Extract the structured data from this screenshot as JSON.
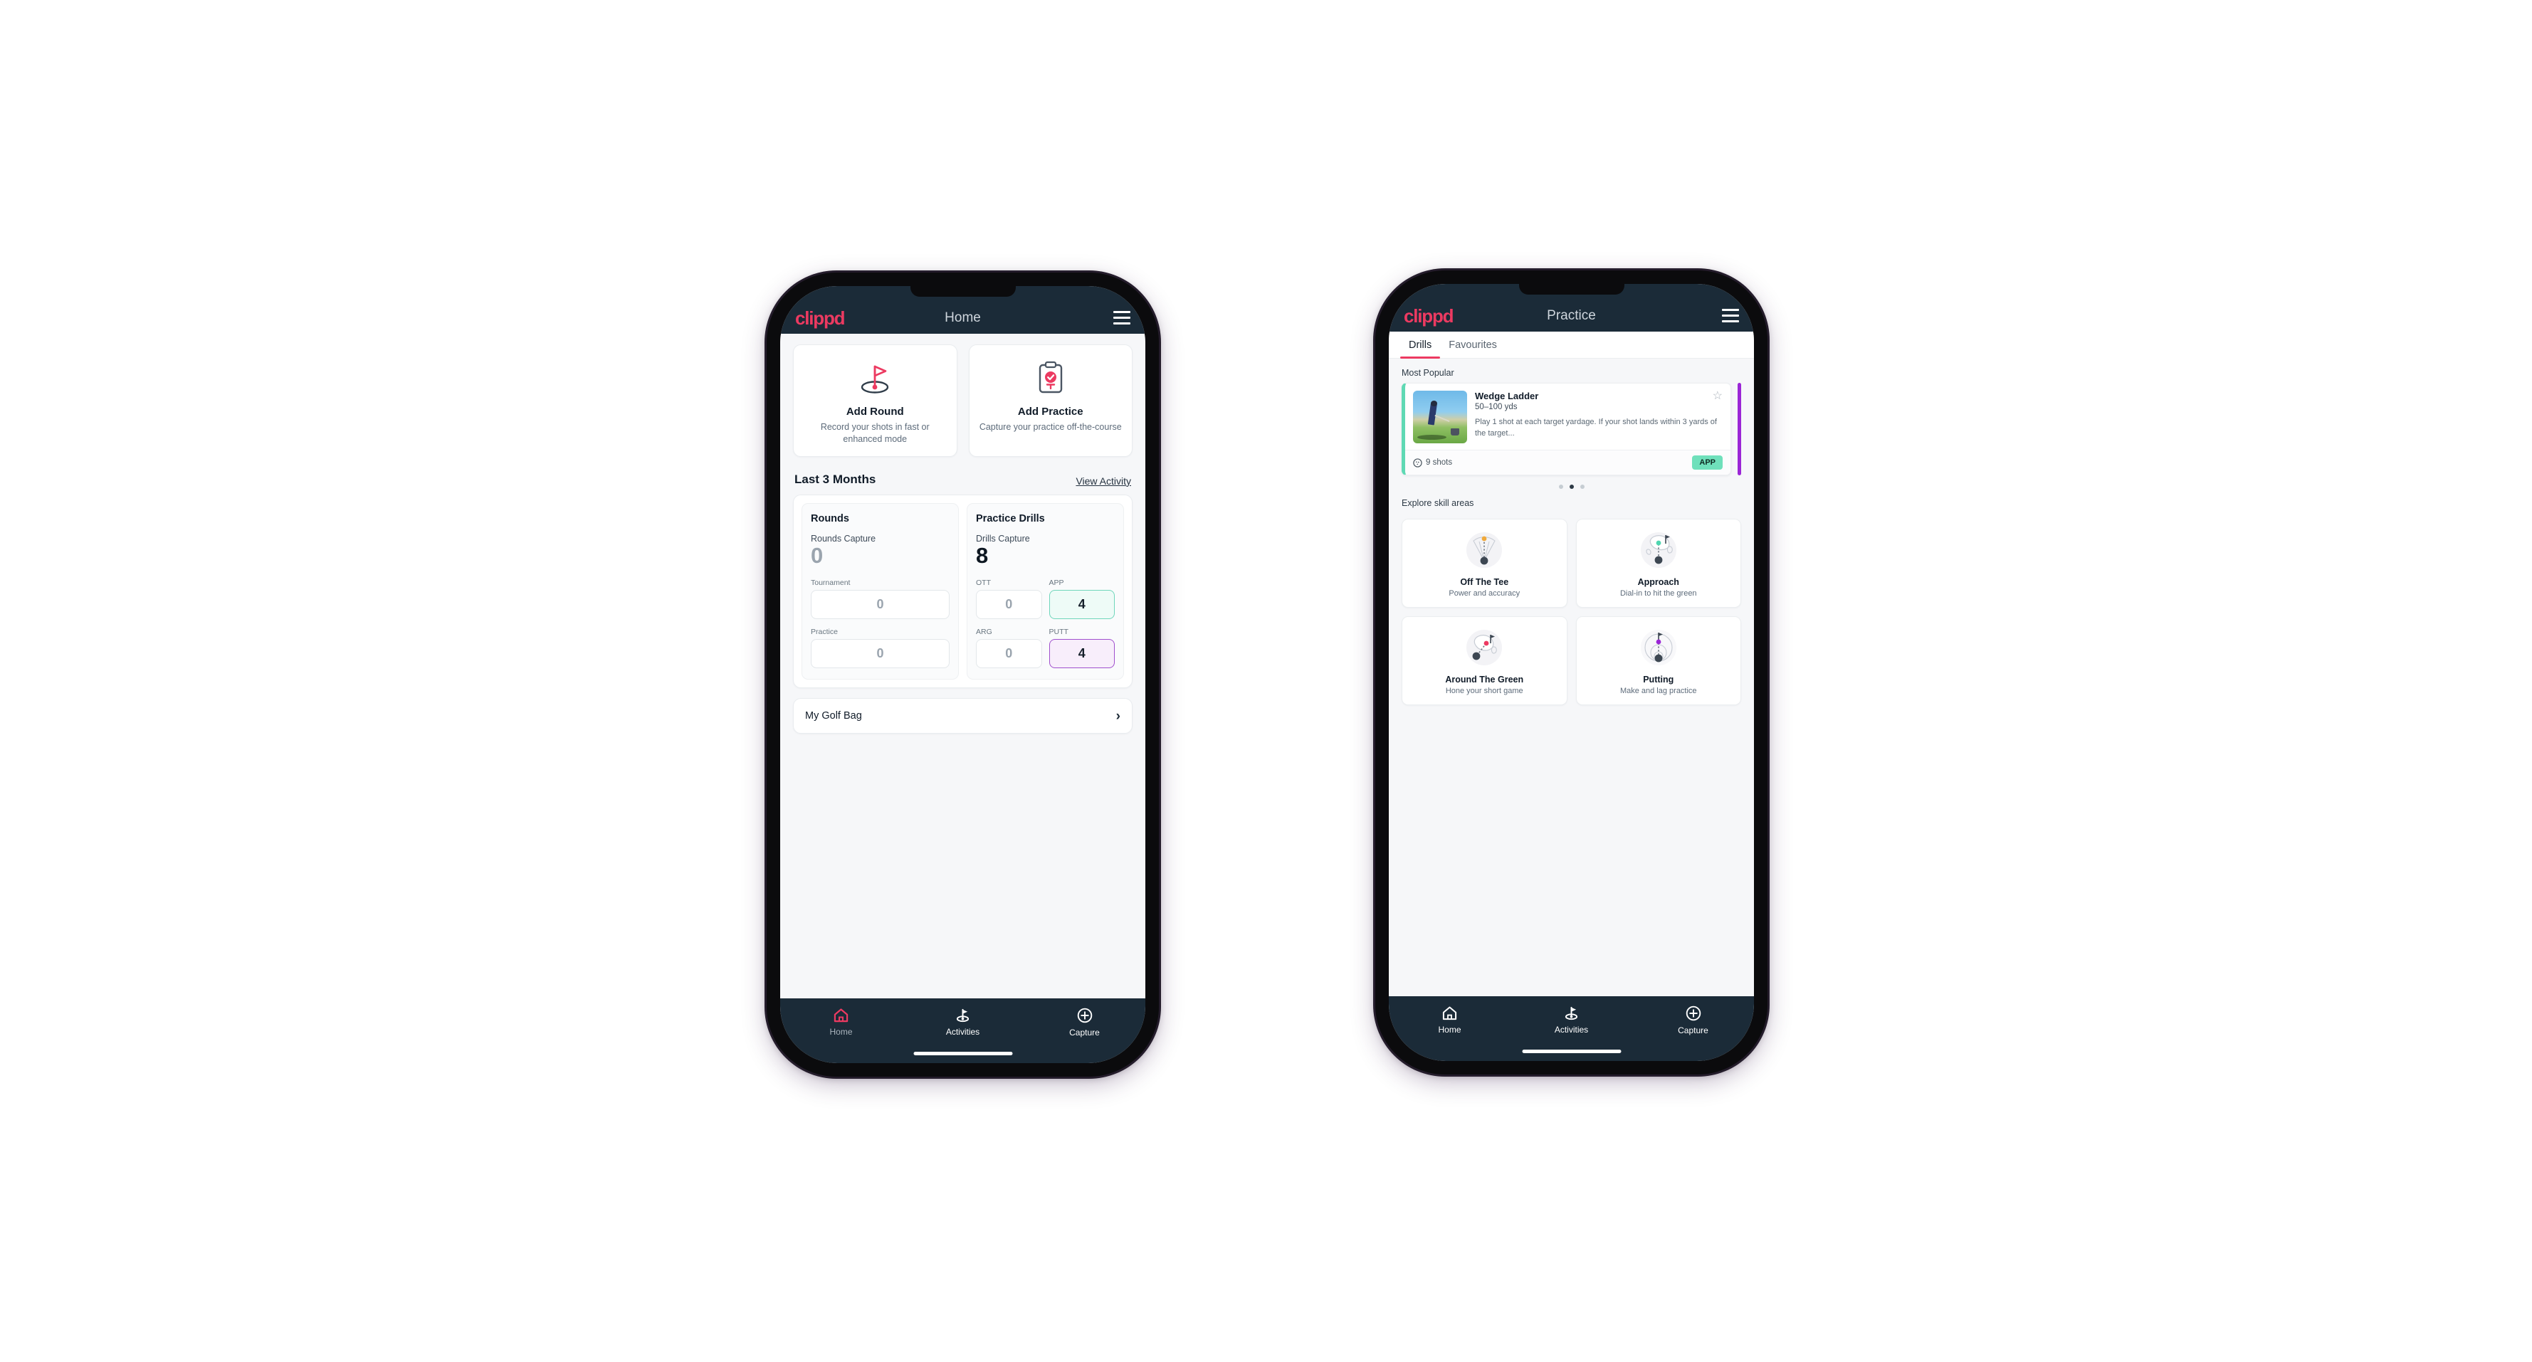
{
  "brand": {
    "name": "clippd",
    "accent": "#ec3a61",
    "navy": "#1b2b38"
  },
  "phone1": {
    "appbar": {
      "logo": "clippd",
      "title": "Home",
      "menu_icon": "hamburger-icon"
    },
    "quick_actions": [
      {
        "icon": "golf-flag-icon",
        "title": "Add Round",
        "subtitle": "Record your shots in fast or enhanced mode"
      },
      {
        "icon": "clipboard-check-icon",
        "title": "Add Practice",
        "subtitle": "Capture your practice off-the-course"
      }
    ],
    "section": {
      "title": "Last 3 Months",
      "link": "View Activity"
    },
    "rounds": {
      "heading": "Rounds",
      "capture_label": "Rounds Capture",
      "capture_value": "0",
      "fields": [
        {
          "label": "Tournament",
          "value": "0",
          "state": "empty"
        },
        {
          "label": "Practice",
          "value": "0",
          "state": "empty"
        }
      ]
    },
    "drills": {
      "heading": "Practice Drills",
      "capture_label": "Drills Capture",
      "capture_value": "8",
      "fields": [
        {
          "label": "OTT",
          "value": "0",
          "state": "empty"
        },
        {
          "label": "APP",
          "value": "4",
          "state": "app"
        },
        {
          "label": "ARG",
          "value": "0",
          "state": "empty"
        },
        {
          "label": "PUTT",
          "value": "4",
          "state": "putt"
        }
      ]
    },
    "golf_bag": {
      "label": "My Golf Bag",
      "chevron": "chevron-right-icon"
    },
    "bottom_nav": [
      {
        "icon": "home-icon",
        "label": "Home",
        "icon_color": "#ec3a61",
        "label_dim": true
      },
      {
        "icon": "golf-flag-nav-icon",
        "label": "Activities",
        "icon_color": "#ffffff",
        "label_dim": false
      },
      {
        "icon": "plus-circle-icon",
        "label": "Capture",
        "icon_color": "#ffffff",
        "label_dim": false
      }
    ]
  },
  "phone2": {
    "appbar": {
      "logo": "clippd",
      "title": "Practice",
      "menu_icon": "hamburger-icon"
    },
    "tabs": [
      {
        "label": "Drills",
        "active": true
      },
      {
        "label": "Favourites",
        "active": false
      }
    ],
    "most_popular_label": "Most Popular",
    "drill_card": {
      "accent_color": "#5fd9b4",
      "title": "Wedge Ladder",
      "yardage": "50–100 yds",
      "description": "Play 1 shot at each target yardage. If your shot lands within 3 yards of the target...",
      "shots": "9 shots",
      "shots_icon": "golf-ball-icon",
      "badge": "APP",
      "badge_color": "#6fe0bb",
      "favourite_icon": "star-outline-icon",
      "thumbnail": "golfer-chipping-photo",
      "next_card_accent": "#9b26d6"
    },
    "carousel_dots": {
      "count": 3,
      "active_index": 1
    },
    "explore_label": "Explore skill areas",
    "skill_areas": [
      {
        "icon": "tee-dispersion-icon",
        "dot_color": "#f0a93b",
        "name": "Off The Tee",
        "subtitle": "Power and accuracy"
      },
      {
        "icon": "approach-green-icon",
        "dot_color": "#4fd6b0",
        "name": "Approach",
        "subtitle": "Dial-in to hit the green"
      },
      {
        "icon": "around-green-icon",
        "dot_color": "#ec3a61",
        "name": "Around The Green",
        "subtitle": "Hone your short game"
      },
      {
        "icon": "putting-rings-icon",
        "dot_color": "#9b26d6",
        "name": "Putting",
        "subtitle": "Make and lag practice"
      }
    ],
    "bottom_nav": [
      {
        "icon": "home-icon",
        "label": "Home",
        "icon_color": "#ffffff",
        "label_dim": false
      },
      {
        "icon": "golf-flag-nav-icon",
        "label": "Activities",
        "icon_color": "#ffffff",
        "label_dim": false
      },
      {
        "icon": "plus-circle-icon",
        "label": "Capture",
        "icon_color": "#ffffff",
        "label_dim": false
      }
    ]
  }
}
